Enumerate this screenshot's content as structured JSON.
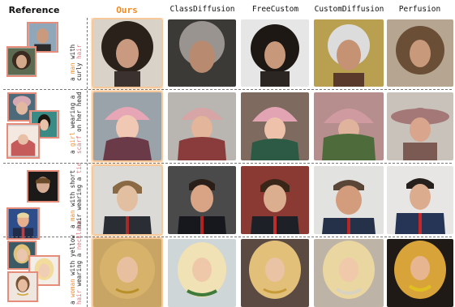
{
  "headers": {
    "reference": "Reference",
    "ours": "Ours",
    "classdiffusion": "ClassDiffusion",
    "freecustom": "FreeCustom",
    "customdiffusion": "CustomDiffusion",
    "perfusion": "Perfusion"
  },
  "colors": {
    "ours_accent": "#f08a24",
    "ours_band": "#fde8d2",
    "highlight": "#e0707a"
  },
  "rows": [
    {
      "prompt_parts": [
        "a ",
        "man",
        " with",
        "curly ",
        "hair"
      ]
    },
    {
      "prompt_parts": [
        "a ",
        "girl",
        " wearing a ",
        "scarf",
        " on her head"
      ]
    },
    {
      "prompt_parts": [
        "a ",
        "man",
        " with short",
        "hair wearing a ",
        "tie"
      ]
    },
    {
      "prompt_parts": [
        "a ",
        "woman",
        " with yellow ",
        "hair",
        " wearing a ",
        "necklace"
      ]
    }
  ]
}
